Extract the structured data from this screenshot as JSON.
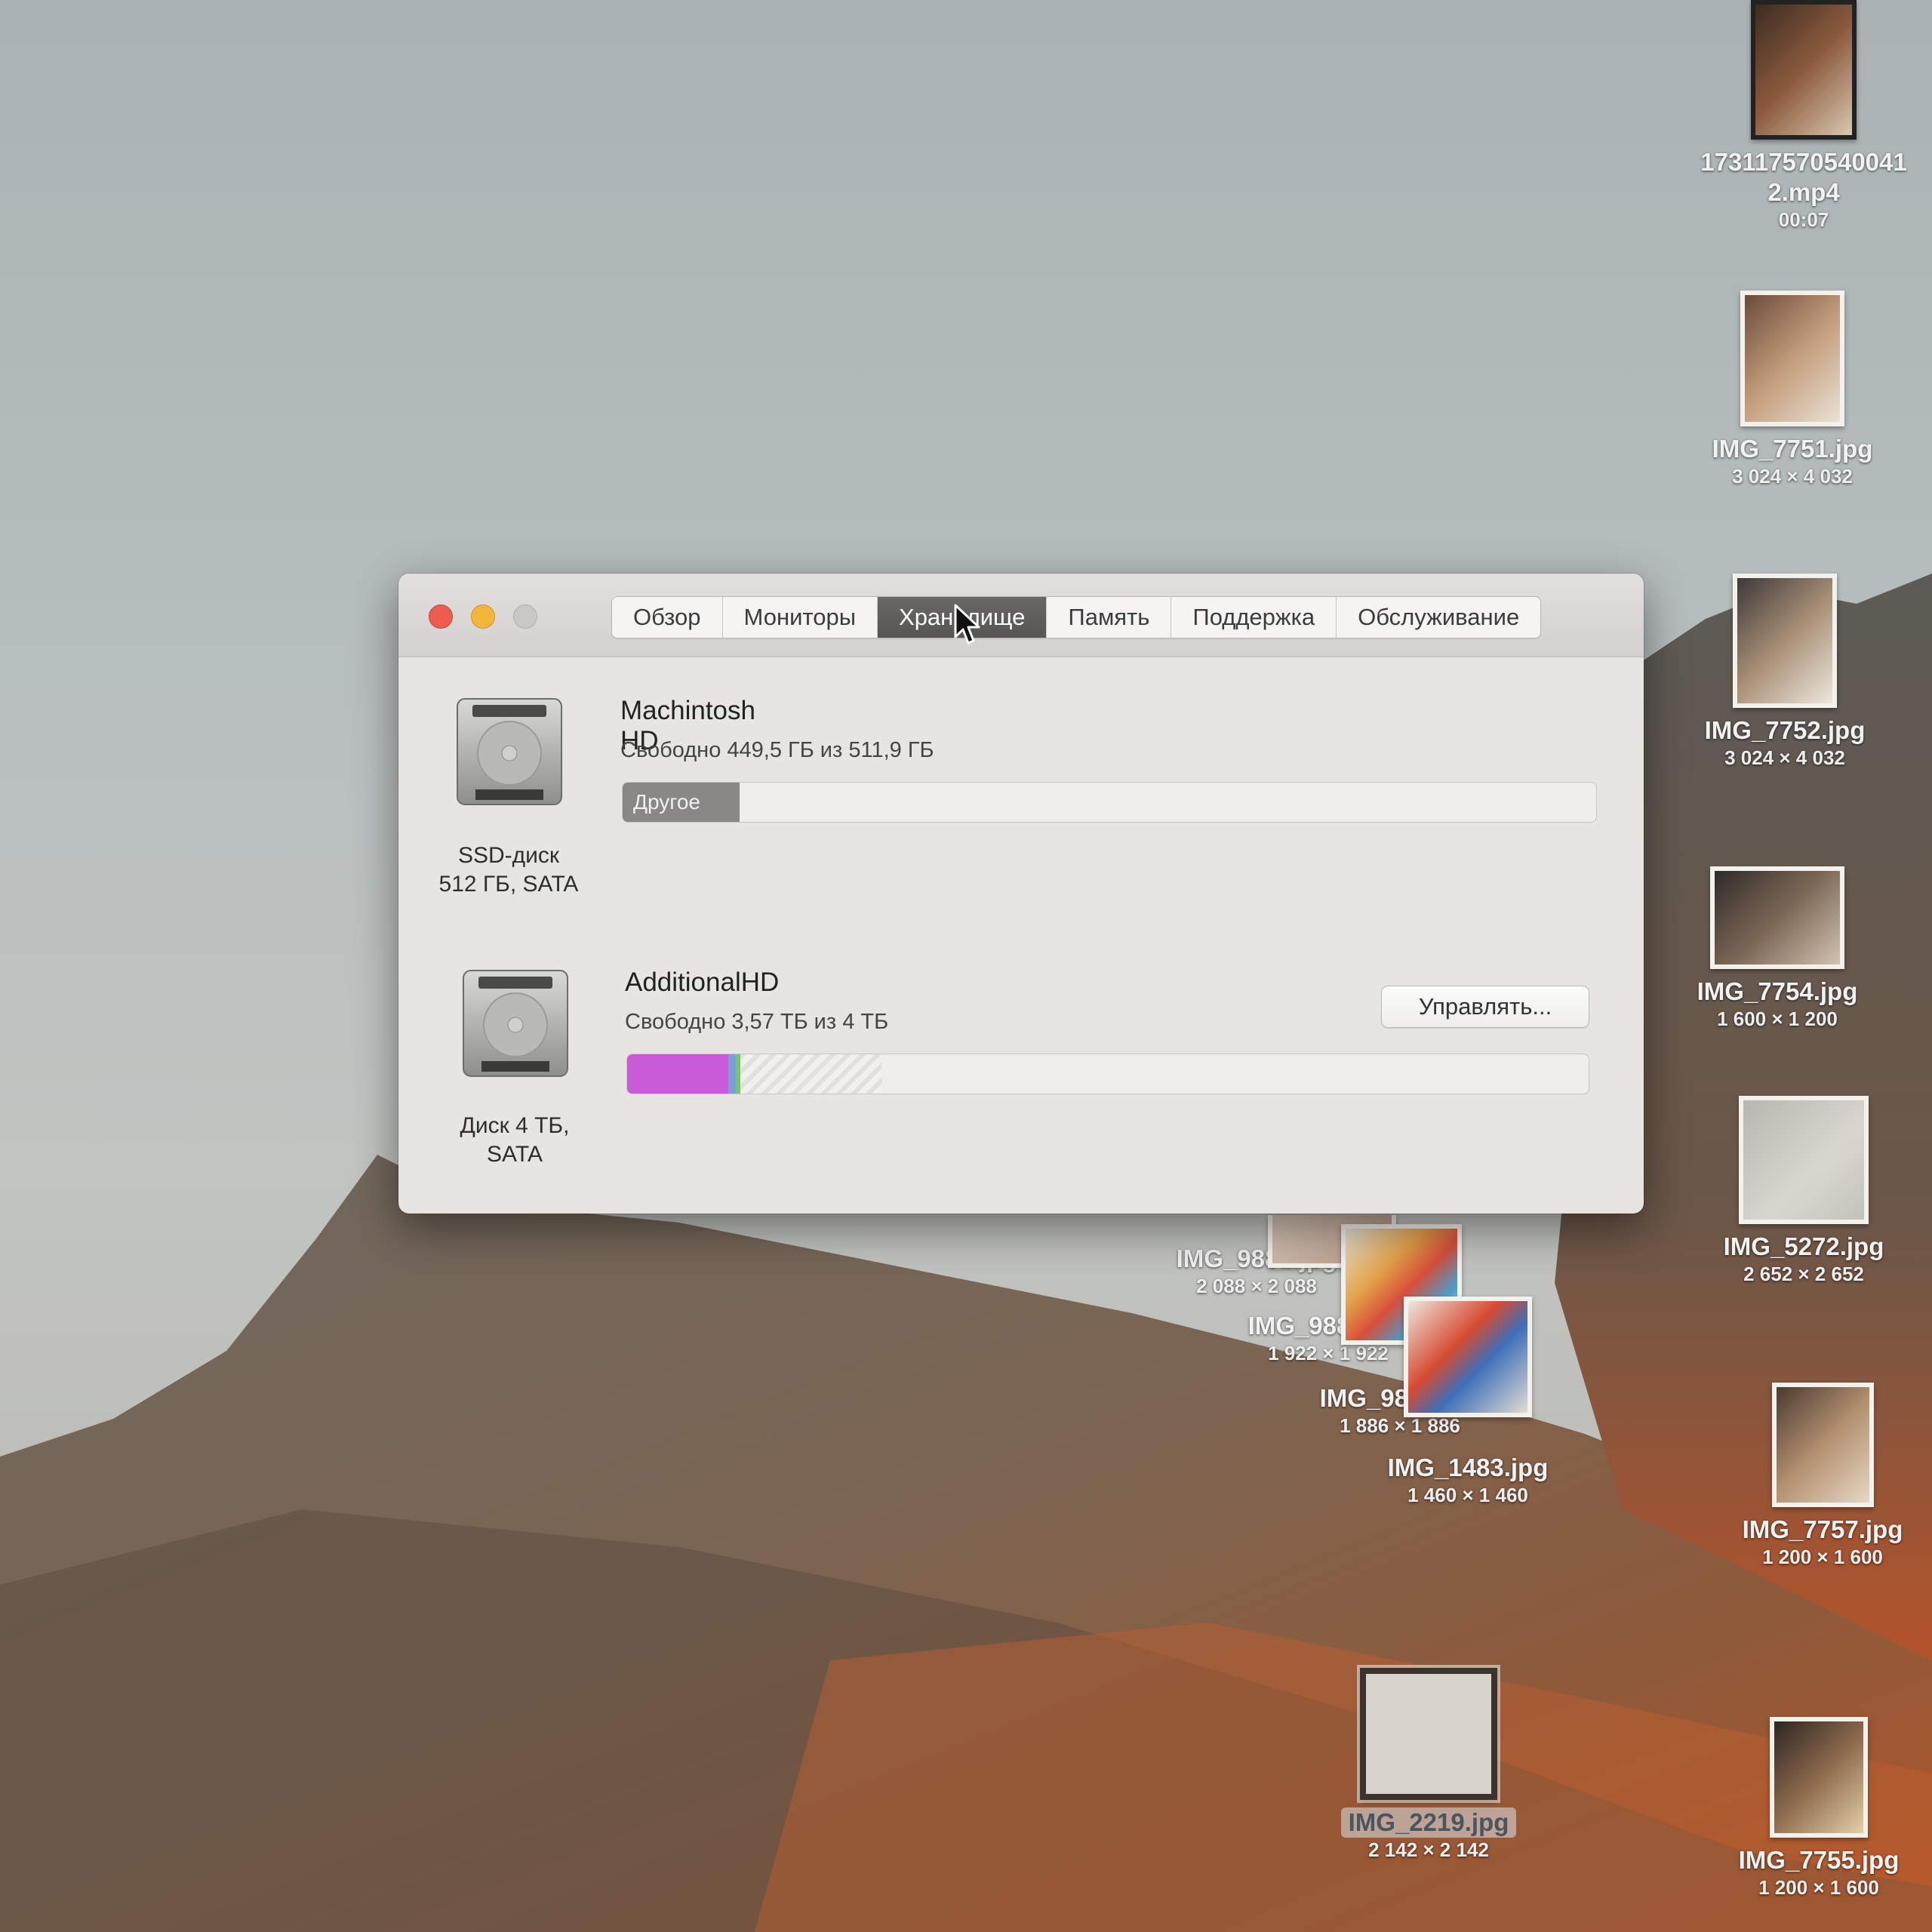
{
  "window": {
    "tabs": [
      {
        "label": "Обзор",
        "active": false
      },
      {
        "label": "Мониторы",
        "active": false
      },
      {
        "label": "Хранилище",
        "active": true
      },
      {
        "label": "Память",
        "active": false
      },
      {
        "label": "Поддержка",
        "active": false
      },
      {
        "label": "Обслуживание",
        "active": false
      }
    ],
    "disks": [
      {
        "type_line1": "SSD-диск",
        "type_line2": "512 ГБ, SATA",
        "name": "Machintosh HD",
        "free_text": "Свободно 449,5 ГБ из 511,9 ГБ",
        "segment_label": "Другое",
        "segment_fraction": 0.12
      },
      {
        "type_line1": "Диск 4 ТБ,",
        "type_line2": "SATA",
        "name": "AdditionalHD",
        "free_text": "Свободно 3,57 ТБ из 4 ТБ",
        "segments_fraction": {
          "magenta": 0.105,
          "blue": 0.008,
          "green": 0.005,
          "hatched_end": 0.265
        }
      }
    ],
    "manage_button": "Управлять..."
  },
  "desktop_icons": [
    {
      "name_line1": "173117570540041",
      "name_line2": "2.mp4",
      "detail": "00:07"
    },
    {
      "name": "IMG_7751.jpg",
      "detail": "3 024 × 4 032"
    },
    {
      "name": "IMG_7752.jpg",
      "detail": "3 024 × 4 032"
    },
    {
      "name": "IMG_7754.jpg",
      "detail": "1 600 × 1 200"
    },
    {
      "name": "IMG_5272.jpg",
      "detail": "2 652 × 2 652"
    },
    {
      "name": "IMG_9881.jpg",
      "detail": "2 088 × 2 088"
    },
    {
      "name": "IMG_9880.jpg",
      "detail": "1 922 × 1 922"
    },
    {
      "name": "IMG_9877.jpg",
      "detail": "1 886 × 1 886"
    },
    {
      "name": "IMG_1483.jpg",
      "detail": "1 460 × 1 460"
    },
    {
      "name": "IMG_7757.jpg",
      "detail": "1 200 × 1 600"
    },
    {
      "name": "IMG_2219.jpg",
      "detail": "2 142 × 2 142"
    },
    {
      "name": "IMG_7755.jpg",
      "detail": "1 200 × 1 600"
    }
  ],
  "colors": {
    "close": "#ee5b4f",
    "minimize": "#f1b63a",
    "zoom": "#c9c7c4",
    "segment_other": "#8a8886",
    "segment_magenta": "#c95ad8",
    "segment_blue": "#7aa0d8",
    "segment_green": "#7cc36a"
  },
  "icons": [
    "close-icon",
    "minimize-icon",
    "zoom-icon",
    "hard-drive-icon",
    "mouse-pointer-icon"
  ]
}
